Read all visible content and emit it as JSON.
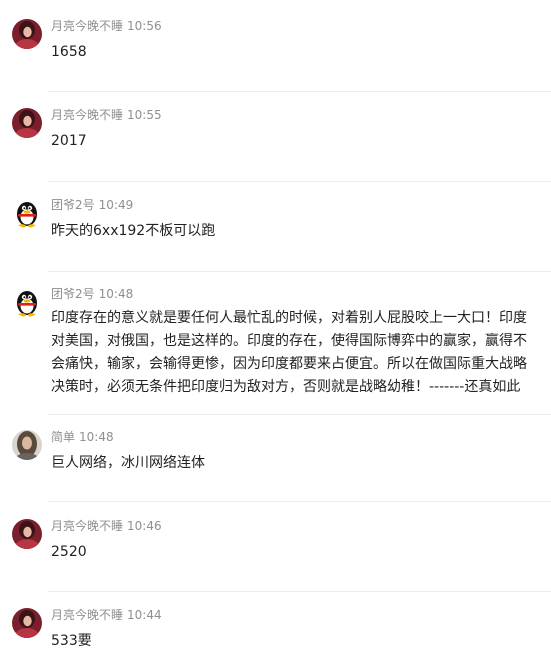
{
  "comments": [
    {
      "avatar": "woman-red-photo",
      "name": "月亮今晚不睡",
      "time": "10:56",
      "text": "1658"
    },
    {
      "avatar": "woman-red-photo",
      "name": "月亮今晚不睡",
      "time": "10:55",
      "text": "2017"
    },
    {
      "avatar": "qq-penguin",
      "name": "团爷2号",
      "time": "10:49",
      "text": "昨天的6xx192不板可以跑"
    },
    {
      "avatar": "qq-penguin",
      "name": "团爷2号",
      "time": "10:48",
      "text": "印度存在的意义就是要任何人最忙乱的时候，对着别人屁股咬上一大口！印度对美国，对俄国，也是这样的。印度的存在，使得国际博弈中的赢家，赢得不会痛快，输家，会输得更惨，因为印度都要来占便宜。所以在做国际重大战略决策时，必须无条件把印度归为敌对方，否则就是战略幼稚！-------还真如此"
    },
    {
      "avatar": "woman-gray-photo",
      "name": "简单",
      "time": "10:48",
      "text": "巨人网络，冰川网络连体"
    },
    {
      "avatar": "woman-red-photo",
      "name": "月亮今晚不睡",
      "time": "10:46",
      "text": "2520"
    },
    {
      "avatar": "woman-red-photo",
      "name": "月亮今晚不睡",
      "time": "10:44",
      "text": "533要"
    }
  ]
}
